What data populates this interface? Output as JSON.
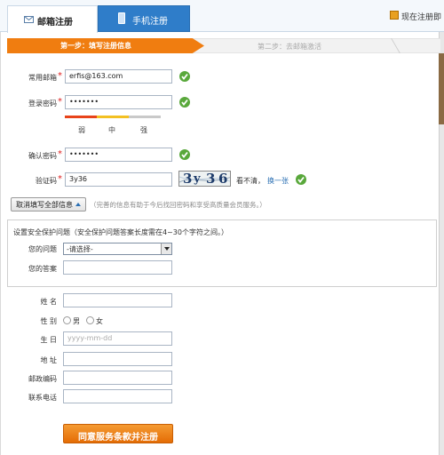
{
  "tabs": {
    "email": "邮箱注册",
    "phone": "手机注册",
    "login_link": "现在注册即"
  },
  "steps": {
    "step1": "第一步：填写注册信息",
    "step2": "第二步：去邮箱激活"
  },
  "form": {
    "email_label": "常用邮箱",
    "email_value": "erfis@163.com",
    "password_label": "登录密码",
    "password_value": "•••••••",
    "strength_weak": "弱",
    "strength_medium": "中",
    "strength_strong": "强",
    "confirm_label": "确认密码",
    "confirm_value": "•••••••",
    "captcha_label": "验证码",
    "captcha_value": "3y36",
    "captcha_image_text": [
      "3",
      "y",
      "3",
      "6"
    ],
    "captcha_unclear": "看不清，",
    "captcha_refresh": "换一张",
    "required_mark": "*"
  },
  "optional": {
    "cancel_button": "取消填写全部信息",
    "hint": "（完善的信息有助于今后找回密码和享受高质量会员服务。）"
  },
  "security": {
    "title": "设置安全保护问题（安全保护问题答案长度需在4~30个字符之间。）",
    "question_label": "您的问题",
    "question_selected": "-请选择-",
    "answer_label": "您的答案"
  },
  "profile": {
    "name_label": "姓  名",
    "gender_label": "性  别",
    "gender_male": "男",
    "gender_female": "女",
    "birthday_label": "生  日",
    "birthday_placeholder": "yyyy-mm-dd",
    "address_label": "地  址",
    "postcode_label": "邮政编码",
    "phone_label": "联系电话"
  },
  "submit_button": "同意服务条款并注册",
  "colors": {
    "accent_orange": "#f07d10",
    "tab_blue": "#2f7dc9",
    "success_green": "#59a83b",
    "link_blue": "#2a6fb3"
  }
}
